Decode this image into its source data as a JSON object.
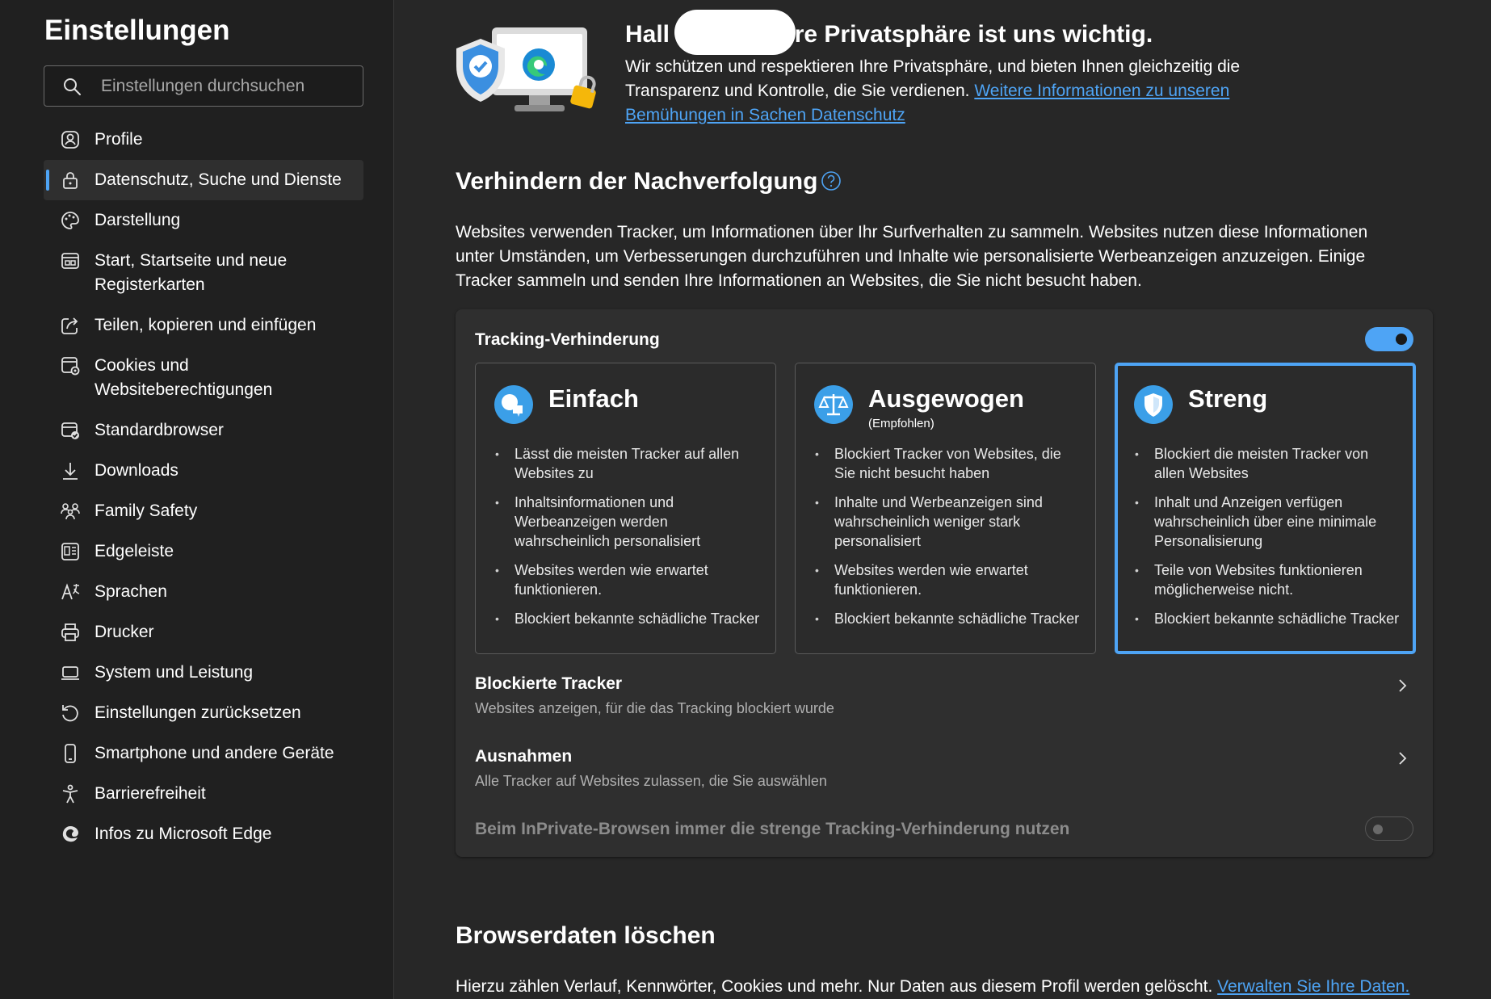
{
  "sidebar": {
    "title": "Einstellungen",
    "search_placeholder": "Einstellungen durchsuchen",
    "items": [
      {
        "label": "Profile",
        "icon": "profile-icon"
      },
      {
        "label": "Datenschutz, Suche und Dienste",
        "icon": "lock-icon",
        "active": true
      },
      {
        "label": "Darstellung",
        "icon": "palette-icon"
      },
      {
        "label": "Start, Startseite und neue Registerkarten",
        "icon": "start-page-icon"
      },
      {
        "label": "Teilen, kopieren und einfügen",
        "icon": "share-icon"
      },
      {
        "label": "Cookies und Websiteberechtigungen",
        "icon": "cookies-icon"
      },
      {
        "label": "Standardbrowser",
        "icon": "default-browser-icon"
      },
      {
        "label": "Downloads",
        "icon": "download-icon"
      },
      {
        "label": "Family Safety",
        "icon": "family-icon"
      },
      {
        "label": "Edgeleiste",
        "icon": "sidebar-panel-icon"
      },
      {
        "label": "Sprachen",
        "icon": "language-icon"
      },
      {
        "label": "Drucker",
        "icon": "printer-icon"
      },
      {
        "label": "System und Leistung",
        "icon": "laptop-icon"
      },
      {
        "label": "Einstellungen zurücksetzen",
        "icon": "reset-icon"
      },
      {
        "label": "Smartphone und andere Geräte",
        "icon": "phone-icon"
      },
      {
        "label": "Barrierefreiheit",
        "icon": "accessibility-icon"
      },
      {
        "label": "Infos zu Microsoft Edge",
        "icon": "edge-icon"
      }
    ]
  },
  "hero": {
    "title_start": "Hall",
    "title_end": "Ihre Privatsphäre ist uns wichtig.",
    "text": "Wir schützen und respektieren Ihre Privatsphäre, und bieten Ihnen gleichzeitig die Transparenz und Kontrolle, die Sie verdienen. ",
    "link": "Weitere Informationen zu unseren Bemühungen in Sachen Datenschutz"
  },
  "tracking": {
    "heading": "Verhindern der Nachverfolgung",
    "description": "Websites verwenden Tracker, um Informationen über Ihr Surfverhalten zu sammeln. Websites nutzen diese Informationen unter Umständen, um Verbesserungen durchzuführen und Inhalte wie personalisierte Werbeanzeigen anzuzeigen. Einige Tracker sammeln und senden Ihre Informationen an Websites, die Sie nicht besucht haben.",
    "toggle_label": "Tracking-Verhinderung",
    "toggle_on": true,
    "levels": [
      {
        "name": "Einfach",
        "subtitle": "",
        "selected": false,
        "bullets": [
          "Lässt die meisten Tracker auf allen Websites zu",
          "Inhaltsinformationen und Werbeanzeigen werden wahrscheinlich personalisiert",
          "Websites werden wie erwartet funktionieren.",
          "Blockiert bekannte schädliche Tracker"
        ]
      },
      {
        "name": "Ausgewogen",
        "subtitle": "(Empfohlen)",
        "selected": false,
        "bullets": [
          "Blockiert Tracker von Websites, die Sie nicht besucht haben",
          "Inhalte und Werbeanzeigen sind wahrscheinlich weniger stark personalisiert",
          "Websites werden wie erwartet funktionieren.",
          "Blockiert bekannte schädliche Tracker"
        ]
      },
      {
        "name": "Streng",
        "subtitle": "",
        "selected": true,
        "bullets": [
          "Blockiert die meisten Tracker von allen Websites",
          "Inhalt und Anzeigen verfügen wahrscheinlich über eine minimale Personalisierung",
          "Teile von Websites funktionieren möglicherweise nicht.",
          "Blockiert bekannte schädliche Tracker"
        ]
      }
    ],
    "blocked": {
      "title": "Blockierte Tracker",
      "subtitle": "Websites anzeigen, für die das Tracking blockiert wurde"
    },
    "exceptions": {
      "title": "Ausnahmen",
      "subtitle": "Alle Tracker auf Websites zulassen, die Sie auswählen"
    },
    "inprivate": {
      "label": "Beim InPrivate-Browsen immer die strenge Tracking-Verhinderung nutzen",
      "on": false
    }
  },
  "clear": {
    "heading": "Browserdaten löschen",
    "text": "Hierzu zählen Verlauf, Kennwörter, Cookies und mehr. Nur Daten aus diesem Profil werden gelöscht. ",
    "link": "Verwalten Sie Ihre Daten."
  },
  "colors": {
    "accent": "#4ea4f5",
    "background": "#272727",
    "sidebar": "#202020",
    "card": "#2f2f2f"
  }
}
